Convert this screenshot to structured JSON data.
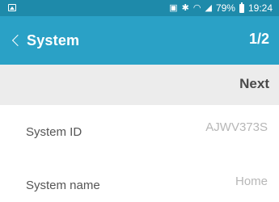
{
  "status_bar": {
    "battery_percent": "79%",
    "time": "19:24",
    "icons": [
      "image-icon",
      "nfc-icon",
      "bluetooth-icon",
      "wifi-icon",
      "signal-icon",
      "battery-icon"
    ]
  },
  "header": {
    "title": "System",
    "page_indicator": "1/2",
    "background_color": "#2aa1c6"
  },
  "toolbar": {
    "next_label": "Next"
  },
  "fields": [
    {
      "label": "System ID",
      "value": "AJWV373S"
    },
    {
      "label": "System name",
      "value": "Home"
    }
  ]
}
